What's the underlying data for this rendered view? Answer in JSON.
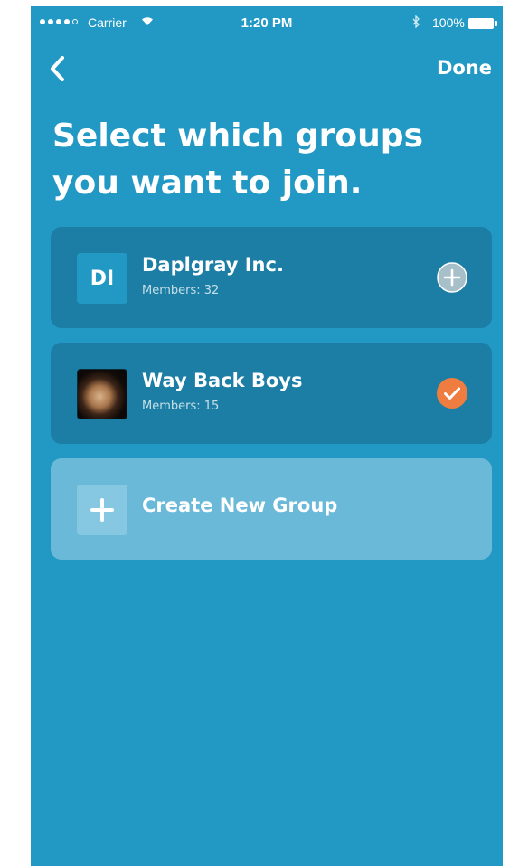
{
  "status_bar": {
    "carrier": "Carrier",
    "time": "1:20 PM",
    "battery": "100%"
  },
  "nav": {
    "back_icon": "chevron-left-icon",
    "done_label": "Done"
  },
  "title": "Select which groups you want to join.",
  "groups": [
    {
      "initials": "DI",
      "name": "Daplgray Inc.",
      "members": "Members: 32",
      "state": "not-joined",
      "action_icon": "plus-circle-icon"
    },
    {
      "initials": "",
      "name": "Way Back Boys",
      "members": "Members: 15",
      "state": "selected",
      "action_icon": "check-circle-icon"
    }
  ],
  "create_group": {
    "label": "Create New Group",
    "icon": "plus-icon"
  },
  "colors": {
    "background": "#2299c5",
    "card": "#1c7ea4",
    "create_card": "#6ab9d8",
    "selected_accent": "#ef7d3f"
  }
}
